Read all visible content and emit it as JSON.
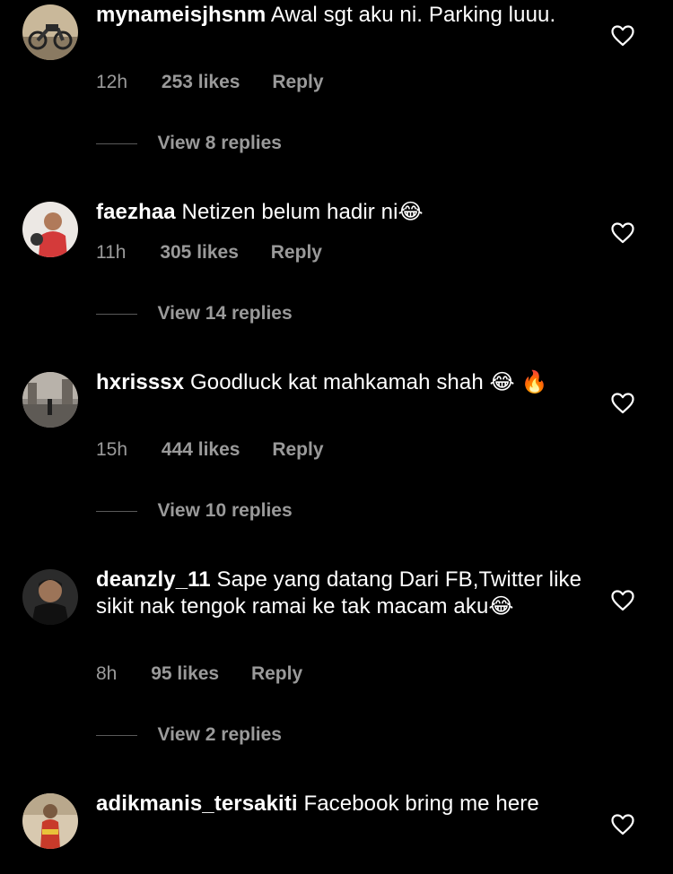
{
  "comments": [
    {
      "username": "mynameisjhsnm",
      "text": "Awal sgt aku ni. Parking luuu.",
      "time": "12h",
      "likes": "253 likes",
      "reply": "Reply",
      "view_replies": "View 8 replies"
    },
    {
      "username": "faezhaa",
      "text": "Netizen belum hadir ni😂",
      "time": "11h",
      "likes": "305 likes",
      "reply": "Reply",
      "view_replies": "View 14 replies"
    },
    {
      "username": "hxrisssx",
      "text": "Goodluck kat mahkamah shah 😂 🔥",
      "time": "15h",
      "likes": "444 likes",
      "reply": "Reply",
      "view_replies": "View 10 replies"
    },
    {
      "username": "deanzly_11",
      "text": "Sape  yang datang Dari FB,Twitter like sikit nak tengok ramai ke tak macam aku😂",
      "time": "8h",
      "likes": "95 likes",
      "reply": "Reply",
      "view_replies": "View 2 replies"
    },
    {
      "username": "adikmanis_tersakiti",
      "text": "Facebook bring me here"
    }
  ],
  "colors": {
    "background": "#000000",
    "text": "#ffffff",
    "secondary": "#9a9a9a",
    "divider": "#5a5a5a"
  },
  "icons": {
    "like": "heart-outline-icon"
  }
}
